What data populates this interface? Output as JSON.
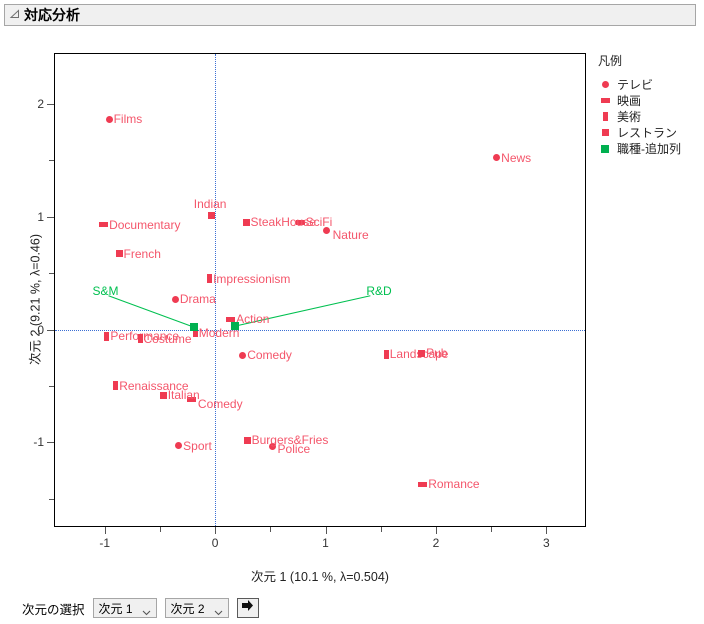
{
  "window": {
    "title": "対応分析",
    "disclosure_icon": "triangle-collapse-icon"
  },
  "chart_data": {
    "type": "scatter",
    "title": "対応分析",
    "xlabel": "次元 1  (10.1 %, λ=0.504)",
    "ylabel": "次元 2  (9.21 %, λ=0.46)",
    "xlim": [
      -1.45,
      3.35
    ],
    "ylim": [
      -1.74,
      2.44
    ],
    "xticks": [
      -1,
      0,
      1,
      2,
      3
    ],
    "yticks": [
      2,
      1,
      0,
      -1
    ],
    "grid": false,
    "reference_lines": {
      "x": 0,
      "y": 0,
      "style": "dotted",
      "color": "#3b6fd4"
    },
    "legend": {
      "position": "right",
      "title": "凡例",
      "entries": [
        {
          "label": "テレビ",
          "marker": "circle",
          "color": "#ef3b52"
        },
        {
          "label": "映画",
          "marker": "hbar",
          "color": "#ef3b52"
        },
        {
          "label": "美術",
          "marker": "vbar",
          "color": "#ef3b52"
        },
        {
          "label": "レストラン",
          "marker": "square",
          "color": "#ef3b52"
        },
        {
          "label": "職種-追加列",
          "marker": "gsquare",
          "color": "#00b050"
        }
      ]
    },
    "series": [
      {
        "name": "テレビ",
        "marker": "circle",
        "color": "#ef3b52",
        "points": [
          {
            "label": "Films",
            "x": -0.96,
            "y": 1.86
          },
          {
            "label": "News",
            "x": 2.55,
            "y": 1.52
          },
          {
            "label": "Nature",
            "x": 1.01,
            "y": 0.88
          },
          {
            "label": "Drama",
            "x": -0.36,
            "y": 0.27
          },
          {
            "label": "Comedy",
            "x": 0.25,
            "y": -0.23
          },
          {
            "label": "Sport",
            "x": -0.33,
            "y": -1.03
          },
          {
            "label": "Police",
            "x": 0.52,
            "y": -1.04
          }
        ]
      },
      {
        "name": "映画",
        "marker": "hbar",
        "color": "#ef3b52",
        "points": [
          {
            "label": "Documentary",
            "x": -1.01,
            "y": 0.93
          },
          {
            "label": "SciFi",
            "x": 0.77,
            "y": 0.95
          },
          {
            "label": "Action",
            "x": 0.14,
            "y": 0.09
          },
          {
            "label": "Comedy",
            "x": -0.21,
            "y": -0.62
          },
          {
            "label": "Romance",
            "x": 1.88,
            "y": -1.37
          }
        ]
      },
      {
        "name": "美術",
        "marker": "vbar",
        "color": "#ef3b52",
        "points": [
          {
            "label": "Impressionism",
            "x": -0.05,
            "y": 0.45
          },
          {
            "label": "Performance",
            "x": -0.98,
            "y": -0.06
          },
          {
            "label": "Costume",
            "x": -0.68,
            "y": -0.08
          },
          {
            "label": "Modern",
            "x": -0.18,
            "y": -0.03
          },
          {
            "label": "Renaissance",
            "x": -0.9,
            "y": -0.5
          },
          {
            "label": "Landscape",
            "x": 1.55,
            "y": -0.22
          }
        ]
      },
      {
        "name": "レストラン",
        "marker": "square",
        "color": "#ef3b52",
        "points": [
          {
            "label": "Indian",
            "x": -0.03,
            "y": 1.01
          },
          {
            "label": "SteakHouse",
            "x": 0.28,
            "y": 0.95
          },
          {
            "label": "French",
            "x": -0.87,
            "y": 0.67
          },
          {
            "label": "Italian",
            "x": -0.47,
            "y": -0.58
          },
          {
            "label": "Burgers&Fries",
            "x": 0.29,
            "y": -0.98
          },
          {
            "label": "Pub",
            "x": 1.87,
            "y": -0.21
          }
        ]
      },
      {
        "name": "職種-追加列",
        "marker": "gsquare",
        "color": "#00b050",
        "points": [
          {
            "label": "S&M",
            "x": -0.19,
            "y": 0.02,
            "label_x": -1.11,
            "label_y": 0.29
          },
          {
            "label": "R&D",
            "x": 0.18,
            "y": 0.03,
            "label_x": 1.37,
            "label_y": 0.29
          }
        ]
      }
    ]
  },
  "controls": {
    "label": "次元の選択",
    "dim_x": {
      "value": "次元 1",
      "chevron": "chevron-down-icon"
    },
    "dim_y": {
      "value": "次元 2",
      "chevron": "chevron-down-icon"
    },
    "go_button": {
      "icon": "arrow-right-icon"
    }
  }
}
